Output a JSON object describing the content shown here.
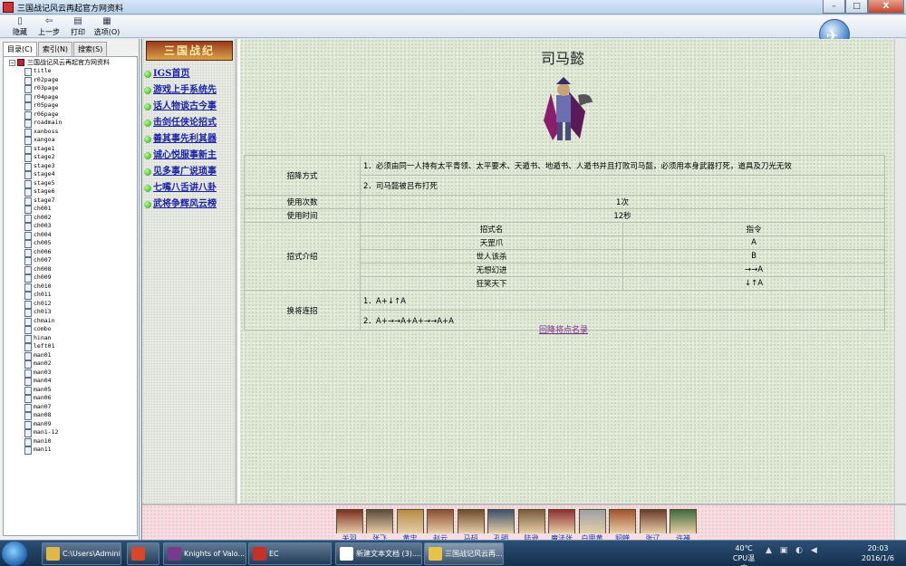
{
  "window": {
    "title": "三国战记风云再起官方网资料"
  },
  "window_buttons": [
    "–",
    "□",
    "X"
  ],
  "toolbar": {
    "buttons": [
      {
        "label": "隐藏",
        "icon": "hide-icon"
      },
      {
        "label": "上一步",
        "icon": "back-arrow-icon"
      },
      {
        "label": "打印",
        "icon": "print-icon"
      },
      {
        "label": "选项(O)",
        "icon": "options-icon"
      }
    ]
  },
  "nav": {
    "tabs": [
      "目录(C)",
      "索引(N)",
      "搜索(S)"
    ],
    "root_label": "三国战记风云再起官方网资料",
    "toggle": "−",
    "items": [
      "title",
      "r02page",
      "r03page",
      "r04page",
      "r05page",
      "r06page",
      "roadmain",
      "xanboss",
      "xangoa",
      "stage1",
      "stage2",
      "stage3",
      "stage4",
      "stage5",
      "stage6",
      "stage7",
      "ch001",
      "ch002",
      "ch003",
      "ch004",
      "ch005",
      "ch006",
      "ch007",
      "ch008",
      "ch009",
      "ch010",
      "ch011",
      "ch012",
      "ch013",
      "chmain",
      "combo",
      "hinan",
      "left01",
      "man01",
      "man02",
      "man03",
      "man04",
      "man05",
      "man06",
      "man07",
      "man08",
      "man09",
      "man1-12",
      "man10",
      "man11"
    ]
  },
  "site_menu": {
    "logo_text": "三国战纪",
    "items": [
      "IGS首页",
      "游戏上手系统先",
      "话人物谈古今事",
      "击剑任侠论招式",
      "善其事先利其器",
      "诚心悦服事新主",
      "见多事广说琐事",
      "七嘴八舌讲八卦",
      "武将争辉风云榜"
    ]
  },
  "page": {
    "heading": "司马懿",
    "info": {
      "method_label": "招降方式",
      "method_lines": [
        "1．必须由同一人持有太平青领、太平要术、天遁书、地遁书、人遁书并且打败司马懿，必须用本身武器打死，道具及刀光无效",
        "2．司马懿被吕布打死"
      ],
      "uses_label": "使用次数",
      "uses_value": "1次",
      "time_label": "使用时间",
      "time_value": "12秒",
      "moves_label": "招式介绍",
      "moves_header": {
        "name": "招式名",
        "command": "指令"
      },
      "moves": [
        {
          "name": "天罡爪",
          "command": "A"
        },
        {
          "name": "世人该杀",
          "command": "B"
        },
        {
          "name": "无想幻进",
          "command": "→→A"
        },
        {
          "name": "狂笑天下",
          "command": "↓↑A"
        }
      ],
      "combo_label": "换将连招",
      "combo_lines": [
        "1．A+↓↑A",
        "2．A+→→A+A+→→A+A"
      ]
    },
    "back_link": "回降将点名录"
  },
  "characters": [
    {
      "name": "关羽",
      "color": "#7a2f1e"
    },
    {
      "name": "张飞",
      "color": "#5a4a3a"
    },
    {
      "name": "黄忠",
      "color": "#b38b44"
    },
    {
      "name": "赵云",
      "color": "#8a4d2f"
    },
    {
      "name": "马超",
      "color": "#6e4b2c"
    },
    {
      "name": "孔明",
      "color": "#3d4f6b"
    },
    {
      "name": "陆逊",
      "color": "#7a5b3a"
    },
    {
      "name": "魔法张",
      "color": "#8c2f2f"
    },
    {
      "name": "白甲黄",
      "color": "#9aa0a6"
    },
    {
      "name": "貂蝉",
      "color": "#a0522d"
    },
    {
      "name": "张辽",
      "color": "#6b3a2a"
    },
    {
      "name": "许褚",
      "color": "#3f6a3a"
    }
  ],
  "taskbar": {
    "items": [
      {
        "label": "C:\\Users\\Admini...",
        "icon_color": "#e0b84a"
      },
      {
        "label": "",
        "icon_color": "#d9472b"
      },
      {
        "label": "Knights of Valo...",
        "icon_color": "#7a3a8c"
      },
      {
        "label": "EC",
        "icon_color": "#c8302a"
      },
      {
        "label": "新建文本文档 (3)....",
        "icon_color": "#ffffff"
      },
      {
        "label": "三国战记风云再...",
        "icon_color": "#e6c34a"
      }
    ],
    "temperature": "40℃",
    "cpu_label": "CPU温度",
    "time": "20:03",
    "date": "2016/1/6"
  }
}
